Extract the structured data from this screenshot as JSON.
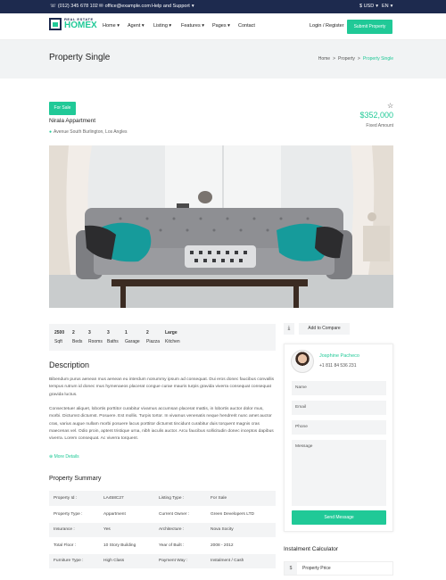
{
  "topbar": {
    "phone": "(012) 345 678 102",
    "email": "office@example.com",
    "help": "Help and Support",
    "currency": "$ USD",
    "language": "EN"
  },
  "logo": {
    "small": "REAL ESTATE",
    "big": "HOMEX"
  },
  "nav": {
    "items": [
      "Home",
      "Agent",
      "Listing",
      "Features",
      "Pages",
      "Contact"
    ],
    "login": "Login / Register",
    "submit": "Submit Property"
  },
  "page": {
    "title": "Property Single",
    "breadcrumb": [
      "Home",
      ">",
      "Property",
      ">",
      "Property Single"
    ]
  },
  "property": {
    "badge": "For Sale",
    "title": "Nirala Appartment",
    "address": "Avenue South Burlington, Los Angles",
    "price": "$352,000",
    "price_label": "Fixed Amount"
  },
  "stats": [
    {
      "value": "2500",
      "label": "Sqft"
    },
    {
      "value": "2",
      "label": "Beds"
    },
    {
      "value": "3",
      "label": "Rooms"
    },
    {
      "value": "3",
      "label": "Baths"
    },
    {
      "value": "1",
      "label": "Garage"
    },
    {
      "value": "2",
      "label": "Piazza"
    },
    {
      "value": "Large",
      "label": "Kitchen"
    }
  ],
  "description": {
    "heading": "Description",
    "p1": "Bibendum purus aenean mus aenean eu interdum nonummy ipsum ad consequat. Dui eros donec faucibus convallis tempus rutrum id donec mus hymenaeos placerat congue curae mauris turpis gravida viverra consequat consequat gravida luctus.",
    "p2": "Consectetuer aliquet, lobortis porttitor curabitur vivamus accumsan placerat mattis, in lobortis auctor dolor mus, morbi. Dictumst dictumst. Posuere. Est mollis. Turpis tortor. In vivamus venenatis neque hendrerit nunc amet auctor cras, varius augue nullam morbi posuere lacus porttitor dictumst tincidunt curabitur duis torquent magnis cras maecenas vel. Odio proin, aptent tristique urna, nibh iaculis auctor. Arcu faucibus sollicitudin donec inceptos dapibus viverra. Lorem consequat. Ac viverra torquent.",
    "more": "More Details"
  },
  "summary": {
    "heading": "Property Summary",
    "rows": [
      [
        "Property Id :",
        "LA458C27",
        "Listing Type :",
        "For Sale"
      ],
      [
        "Property Type :",
        "Appartment",
        "Current Owner :",
        "Green Developers LTD"
      ],
      [
        "Insurance :",
        "Yes",
        "Architecture :",
        "Nova Socity"
      ],
      [
        "Total Floor :",
        "10 Story Building",
        "Year of Built :",
        "2008 - 2012"
      ],
      [
        "Furniture Type :",
        "High Class",
        "Payment Way :",
        "Instalment / Cash"
      ]
    ]
  },
  "sidebar": {
    "compare": "Add to Compare",
    "agent_name": "Josphine Pacheco",
    "agent_phone": "+1 811 84 536 231",
    "form": {
      "name": "Name",
      "email": "Email",
      "phone": "Phone",
      "message": "Message",
      "send": "Send Message"
    },
    "calculator_title": "Instalment Calculator",
    "currency_symbol": "$",
    "price_placeholder": "Property Price"
  },
  "colors": {
    "accent": "#20c997",
    "dark": "#1d2a4e"
  }
}
